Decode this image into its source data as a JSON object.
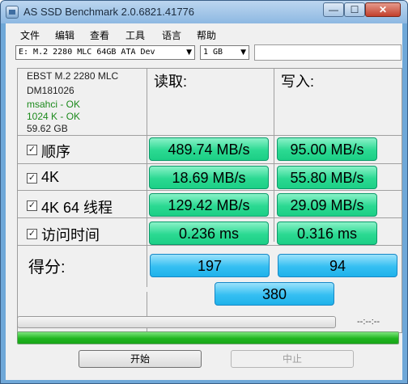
{
  "window": {
    "title": "AS SSD Benchmark 2.0.6821.41776",
    "controls": {
      "minimize": "—",
      "maximize": "☐",
      "close": "✕"
    }
  },
  "menu": [
    "文件",
    "编辑",
    "查看",
    "工具",
    "语言",
    "帮助"
  ],
  "toolbar": {
    "drive": "E: M.2 2280 MLC 64GB ATA Dev",
    "size": "1 GB"
  },
  "drive_info": {
    "model": "EBST M.2 2280 MLC",
    "firmware": "DM181026",
    "driver": "msahci - OK",
    "alignment": "1024 K - OK",
    "capacity": "59.62 GB"
  },
  "columns": {
    "read": "读取:",
    "write": "写入:"
  },
  "rows": [
    {
      "label": "顺序",
      "read": "489.74 MB/s",
      "write": "95.00 MB/s"
    },
    {
      "label": "4K",
      "read": "18.69 MB/s",
      "write": "55.80 MB/s"
    },
    {
      "label": "4K 64 线程",
      "read": "129.42 MB/s",
      "write": "29.09 MB/s"
    },
    {
      "label": "访问时间",
      "read": "0.236 ms",
      "write": "0.316 ms"
    }
  ],
  "score": {
    "label": "得分:",
    "read": "197",
    "write": "94",
    "total": "380"
  },
  "progress": {
    "timer": "--:--:--",
    "bottom_fill_percent": 100
  },
  "buttons": {
    "start": "开始",
    "abort": "中止"
  },
  "colors": {
    "result_green": "#2bd992",
    "score_blue": "#35bff2",
    "progress_green": "#1fb51f"
  }
}
